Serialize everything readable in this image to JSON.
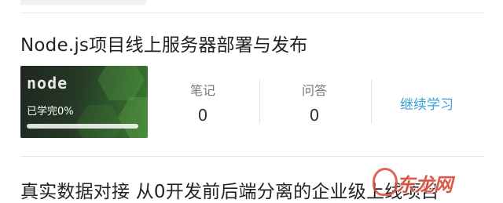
{
  "course1": {
    "title": "Node.js项目线上服务器部署与发布",
    "thumbnail": {
      "logo_text": "node",
      "status_text": "已学完0%",
      "progress": 0
    },
    "stats": [
      {
        "label": "笔记",
        "value": "0"
      },
      {
        "label": "问答",
        "value": "0"
      }
    ],
    "action_label": "继续学习"
  },
  "course2": {
    "title": "真实数据对接 从0开发前后端分离的企业级上线项目"
  },
  "watermark": {
    "text": "东龙网",
    "icon": "logo-mark-icon"
  },
  "colors": {
    "accent": "#3aa0dc",
    "progress": "#4ab15a",
    "watermark": "#d84a3a"
  }
}
